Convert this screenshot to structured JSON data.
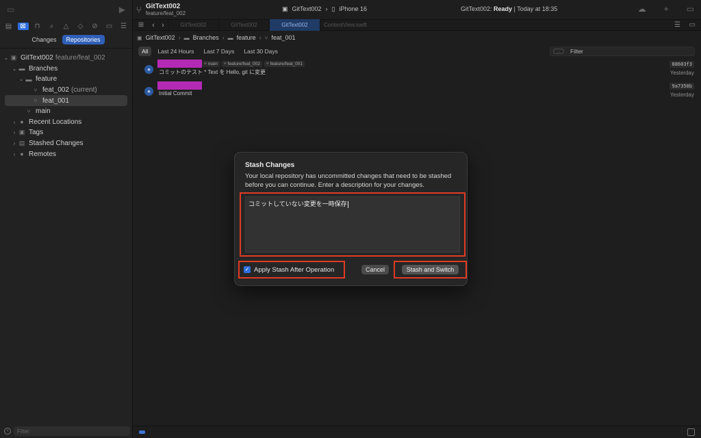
{
  "window": {
    "project_name": "GitText002",
    "project_branch": "feature/feat_002",
    "scheme": "GitText002",
    "device": "iPhone 16",
    "status_prefix": "GitText002: ",
    "status_state": "Ready",
    "status_time": " | Today at 18:35"
  },
  "sidebar": {
    "tabs": [
      "Changes",
      "Repositories"
    ],
    "selected_tab": "Repositories",
    "tree": {
      "repo_name": "GitText002",
      "repo_branch": "feature/feat_002",
      "branches_label": "Branches",
      "feature_label": "feature",
      "feat_002_label": "feat_002",
      "feat_002_note": "(current)",
      "feat_001_label": "feat_001",
      "main_label": "main",
      "recent_label": "Recent Locations",
      "tags_label": "Tags",
      "stashed_label": "Stashed Changes",
      "remotes_label": "Remotes"
    },
    "filter_placeholder": "Filter"
  },
  "tabs": [
    {
      "label": "GitText002"
    },
    {
      "label": "GitText002"
    },
    {
      "label": "GitText002"
    },
    {
      "label": "ContentView.swift"
    }
  ],
  "breadcrumb": [
    "GitText002",
    "Branches",
    "feature",
    "feat_001"
  ],
  "filters": {
    "options": [
      "All",
      "Last 24 Hours",
      "Last 7 Days",
      "Last 30 Days"
    ],
    "selected": "All",
    "search_placeholder": "Filter"
  },
  "commits": [
    {
      "tags": [
        "main",
        "feature/feat_002",
        "feature/feat_001"
      ],
      "message": "コミットのテスト * Text を Hello, git に変更",
      "hash": "88603f3",
      "when": "Yesterday"
    },
    {
      "tags": [],
      "message": "Initial Commit",
      "hash": "9a7358b",
      "when": "Yesterday"
    }
  ],
  "dialog": {
    "title": "Stash Changes",
    "description": "Your local repository has uncommitted changes that need to be stashed before you can continue. Enter a description for your changes.",
    "text_value": "コミットしていない変更を一時保存",
    "checkbox_label": "Apply Stash After Operation",
    "checkbox_checked": true,
    "cancel_label": "Cancel",
    "confirm_label": "Stash and Switch"
  },
  "colors": {
    "accent": "#2f6fde",
    "highlight": "#e23a24",
    "redaction": "#b52ab5"
  }
}
